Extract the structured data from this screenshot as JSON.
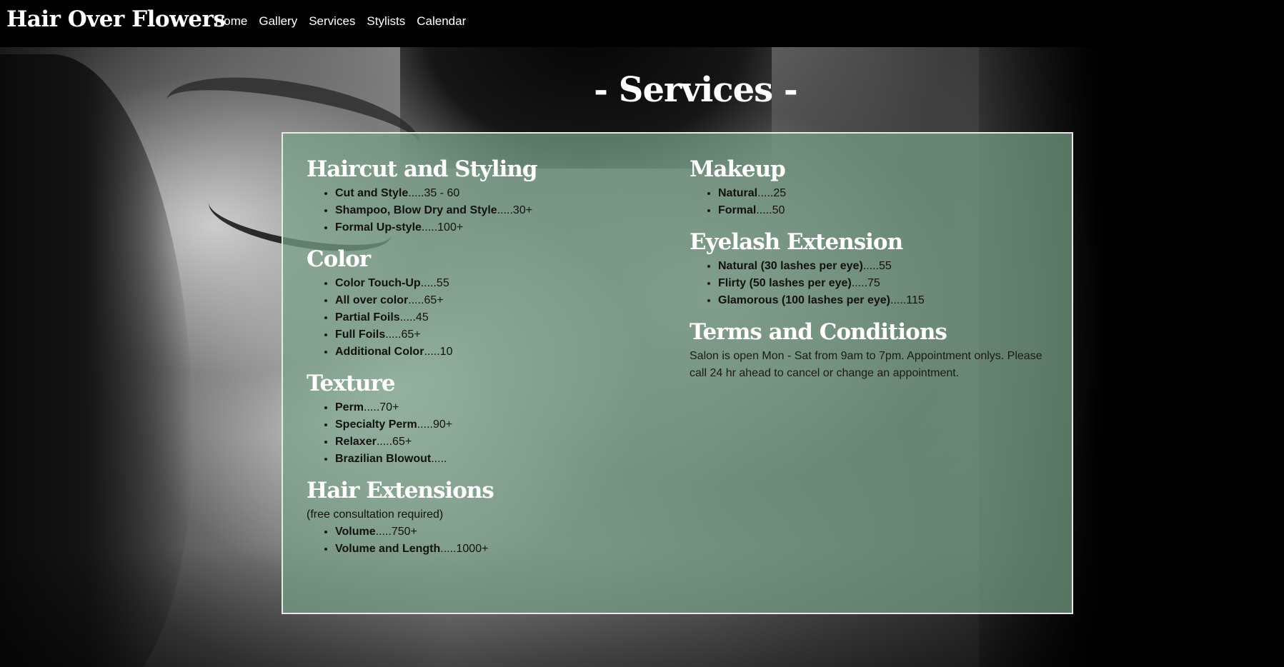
{
  "brand": "Hair Over Flowers",
  "nav": [
    "Home",
    "Gallery",
    "Services",
    "Stylists",
    "Calendar"
  ],
  "heading": "- Services -",
  "left_sections": {
    "haircut": {
      "title": "Haircut and Styling",
      "items": [
        {
          "name": "Cut and Style",
          "price": ".....35 - 60"
        },
        {
          "name": "Shampoo, Blow Dry and Style",
          "price": ".....30+"
        },
        {
          "name": "Formal Up-style",
          "price": ".....100+"
        }
      ]
    },
    "color": {
      "title": "Color",
      "items": [
        {
          "name": "Color Touch-Up",
          "price": ".....55"
        },
        {
          "name": "All over color",
          "price": ".....65+"
        },
        {
          "name": "Partial Foils",
          "price": ".....45"
        },
        {
          "name": "Full Foils",
          "price": ".....65+"
        },
        {
          "name": "Additional Color",
          "price": ".....10"
        }
      ]
    },
    "texture": {
      "title": "Texture",
      "items": [
        {
          "name": "Perm",
          "price": ".....70+"
        },
        {
          "name": "Specialty Perm",
          "price": ".....90+"
        },
        {
          "name": "Relaxer",
          "price": ".....65+"
        },
        {
          "name": "Brazilian Blowout",
          "price": "....."
        }
      ]
    },
    "extensions": {
      "title": "Hair Extensions",
      "note": "(free consultation required)",
      "items": [
        {
          "name": "Volume",
          "price": ".....750+"
        },
        {
          "name": "Volume and Length",
          "price": ".....1000+"
        }
      ]
    }
  },
  "right_sections": {
    "makeup": {
      "title": "Makeup",
      "items": [
        {
          "name": "Natural",
          "price": ".....25"
        },
        {
          "name": "Formal",
          "price": ".....50"
        }
      ]
    },
    "eyelash": {
      "title": "Eyelash Extension",
      "items": [
        {
          "name": "Natural (30 lashes per eye)",
          "price": ".....55"
        },
        {
          "name": "Flirty (50 lashes per eye)",
          "price": ".....75"
        },
        {
          "name": "Glamorous (100 lashes per eye)",
          "price": ".....115"
        }
      ]
    },
    "terms": {
      "title": "Terms and Conditions",
      "text": "Salon is open Mon - Sat from 9am to 7pm. Appointment onlys. Please call 24 hr ahead to cancel or change an appointment."
    }
  },
  "colors": {
    "navbar_bg": "#000000",
    "panel_bg": "#78a087",
    "panel_border": "#e8e8e8",
    "heading_text": "#ffffff"
  }
}
